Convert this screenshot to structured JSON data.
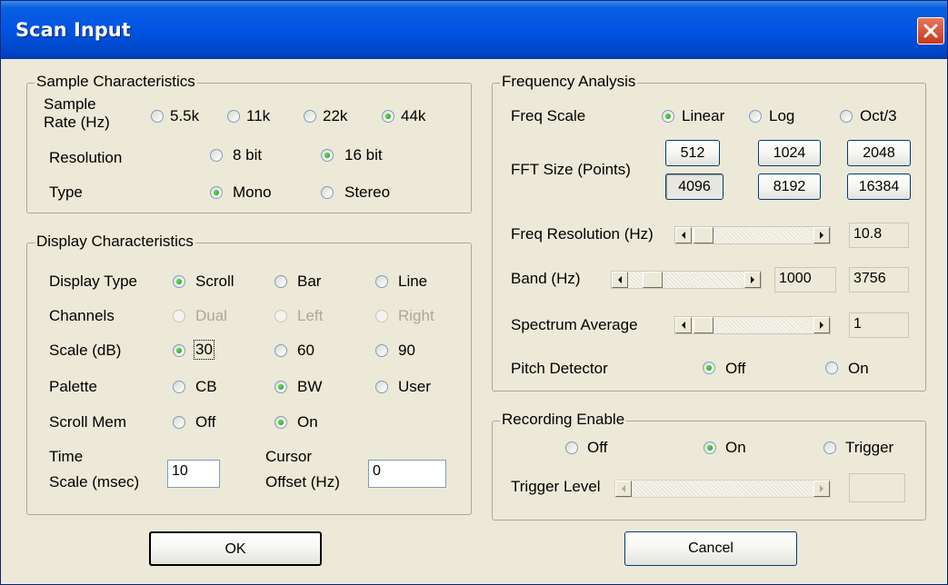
{
  "window": {
    "title": "Scan Input"
  },
  "sample": {
    "title": "Sample Characteristics",
    "rate_label_1": "Sample",
    "rate_label_2": "Rate (Hz)",
    "rates": [
      "5.5k",
      "11k",
      "22k",
      "44k"
    ],
    "rate_selected": "44k",
    "resolution_label": "Resolution",
    "resolutions": [
      "8 bit",
      "16 bit"
    ],
    "resolution_selected": "16 bit",
    "type_label": "Type",
    "types": [
      "Mono",
      "Stereo"
    ],
    "type_selected": "Mono"
  },
  "display": {
    "title": "Display Characteristics",
    "display_type_label": "Display Type",
    "display_types": [
      "Scroll",
      "Bar",
      "Line"
    ],
    "display_type_selected": "Scroll",
    "channels_label": "Channels",
    "channels": [
      "Dual",
      "Left",
      "Right"
    ],
    "channels_enabled": false,
    "scale_label": "Scale (dB)",
    "scales": [
      "30",
      "60",
      "90"
    ],
    "scale_selected": "30",
    "palette_label": "Palette",
    "palettes": [
      "CB",
      "BW",
      "User"
    ],
    "palette_selected": "BW",
    "scroll_mem_label": "Scroll Mem",
    "scroll_mem": [
      "Off",
      "On"
    ],
    "scroll_mem_selected": "On",
    "time_scale_label_1": "Time",
    "time_scale_label_2": "Scale (msec)",
    "time_scale_value": "10",
    "cursor_offset_label_1": "Cursor",
    "cursor_offset_label_2": "Offset (Hz)",
    "cursor_offset_value": "0"
  },
  "frequency": {
    "title": "Frequency Analysis",
    "freq_scale_label": "Freq Scale",
    "freq_scales": [
      "Linear",
      "Log",
      "Oct/3"
    ],
    "freq_scale_selected": "Linear",
    "fft_label": "FFT Size (Points)",
    "fft_sizes": [
      "512",
      "1024",
      "2048",
      "4096",
      "8192",
      "16384"
    ],
    "fft_selected": "4096",
    "freq_resolution_label": "Freq Resolution (Hz)",
    "freq_resolution_value": "10.8",
    "band_label": "Band (Hz)",
    "band_low": "1000",
    "band_high": "3756",
    "spectrum_average_label": "Spectrum Average",
    "spectrum_average_value": "1",
    "pitch_label": "Pitch Detector",
    "pitch_options": [
      "Off",
      "On"
    ],
    "pitch_selected": "Off"
  },
  "recording": {
    "title": "Recording Enable",
    "options": [
      "Off",
      "On",
      "Trigger"
    ],
    "selected": "On",
    "trigger_level_label": "Trigger Level",
    "trigger_level_value": ""
  },
  "buttons": {
    "ok": "OK",
    "cancel": "Cancel"
  }
}
